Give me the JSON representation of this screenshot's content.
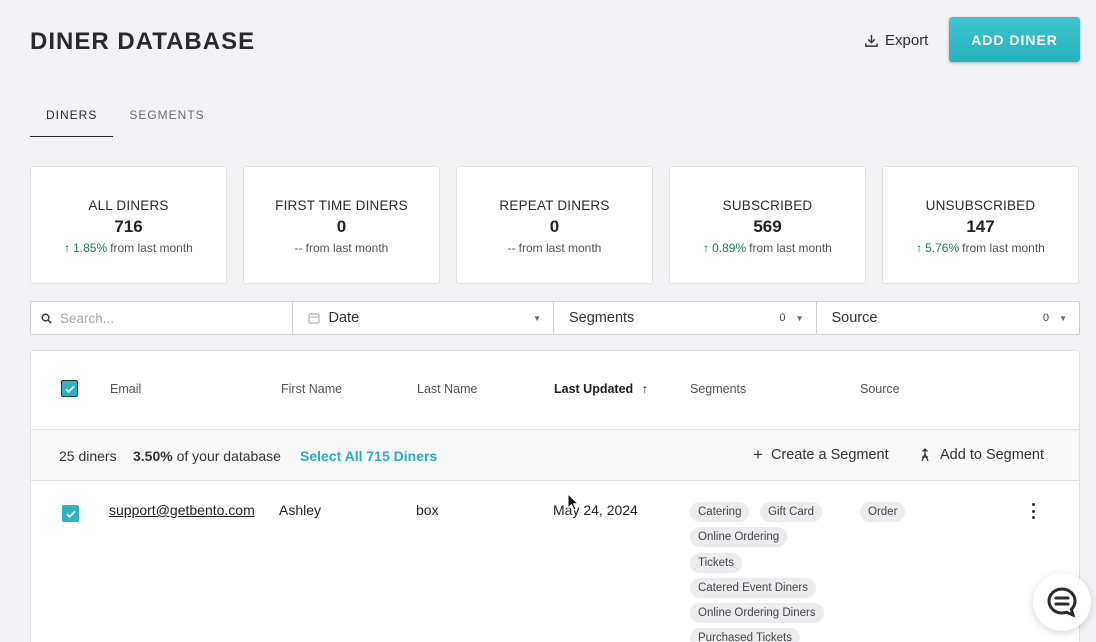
{
  "header": {
    "title": "DINER DATABASE",
    "export_label": "Export",
    "add_label": "ADD DINER"
  },
  "tabs": [
    {
      "label": "DINERS",
      "active": true
    },
    {
      "label": "SEGMENTS",
      "active": false
    }
  ],
  "stats": [
    {
      "label": "ALL DINERS",
      "value": "716",
      "delta_pct": "1.85%",
      "delta_text": "from last month",
      "trend": "up"
    },
    {
      "label": "FIRST TIME DINERS",
      "value": "0",
      "delta_pct": "--",
      "delta_text": "from last month",
      "trend": "none"
    },
    {
      "label": "REPEAT DINERS",
      "value": "0",
      "delta_pct": "--",
      "delta_text": "from last month",
      "trend": "none"
    },
    {
      "label": "SUBSCRIBED",
      "value": "569",
      "delta_pct": "0.89%",
      "delta_text": "from last month",
      "trend": "up"
    },
    {
      "label": "UNSUBSCRIBED",
      "value": "147",
      "delta_pct": "5.76%",
      "delta_text": "from last month",
      "trend": "up"
    }
  ],
  "filters": {
    "search_placeholder": "Search...",
    "date_label": "Date",
    "segments_label": "Segments",
    "segments_count": "0",
    "source_label": "Source",
    "source_count": "0"
  },
  "table": {
    "columns": {
      "email": "Email",
      "first_name": "First Name",
      "last_name": "Last Name",
      "last_updated": "Last Updated",
      "segments": "Segments",
      "source": "Source"
    },
    "selection": {
      "count": "25 diners",
      "pct": "3.50%",
      "pct_suffix": "of your database",
      "select_all": "Select All 715 Diners",
      "create_segment": "Create a Segment",
      "add_to_segment": "Add to Segment"
    },
    "rows": [
      {
        "email": "support@getbento.com",
        "first_name": "Ashley",
        "last_name": "box",
        "last_updated": "May 24, 2024",
        "segments": [
          "Catering",
          "Gift Card",
          "Online Ordering",
          "Tickets",
          "Catered Event Diners",
          "Online Ordering Diners",
          "Purchased Tickets"
        ],
        "source": [
          "Order"
        ]
      }
    ]
  },
  "colors": {
    "accent": "#22b2bd",
    "positive": "#1f7a4d",
    "background": "#f2f2f4"
  }
}
